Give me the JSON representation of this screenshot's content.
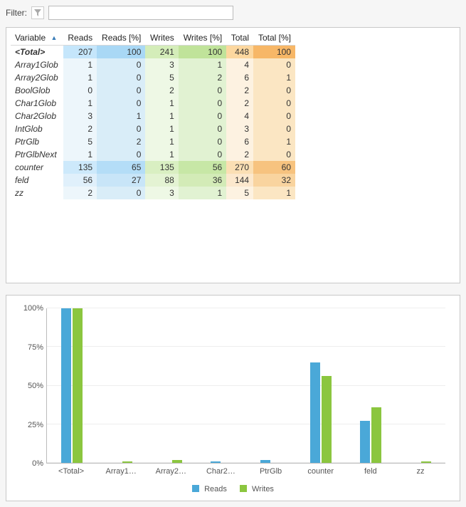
{
  "filter": {
    "label": "Filter:",
    "value": "",
    "placeholder": ""
  },
  "columns": {
    "variable": "Variable",
    "reads": "Reads",
    "reads_pct": "Reads [%]",
    "writes": "Writes",
    "writes_pct": "Writes [%]",
    "total": "Total",
    "total_pct": "Total [%]"
  },
  "rows": [
    {
      "name": "<Total>",
      "reads": 207,
      "reads_pct": 100,
      "writes": 241,
      "writes_pct": 100,
      "total": 448,
      "total_pct": 100,
      "style": "total"
    },
    {
      "name": "Array1Glob",
      "reads": 1,
      "reads_pct": 0,
      "writes": 3,
      "writes_pct": 1,
      "total": 4,
      "total_pct": 0,
      "style": ""
    },
    {
      "name": "Array2Glob",
      "reads": 1,
      "reads_pct": 0,
      "writes": 5,
      "writes_pct": 2,
      "total": 6,
      "total_pct": 1,
      "style": ""
    },
    {
      "name": "BoolGlob",
      "reads": 0,
      "reads_pct": 0,
      "writes": 2,
      "writes_pct": 0,
      "total": 2,
      "total_pct": 0,
      "style": ""
    },
    {
      "name": "Char1Glob",
      "reads": 1,
      "reads_pct": 0,
      "writes": 1,
      "writes_pct": 0,
      "total": 2,
      "total_pct": 0,
      "style": ""
    },
    {
      "name": "Char2Glob",
      "reads": 3,
      "reads_pct": 1,
      "writes": 1,
      "writes_pct": 0,
      "total": 4,
      "total_pct": 0,
      "style": ""
    },
    {
      "name": "IntGlob",
      "reads": 2,
      "reads_pct": 0,
      "writes": 1,
      "writes_pct": 0,
      "total": 3,
      "total_pct": 0,
      "style": ""
    },
    {
      "name": "PtrGlb",
      "reads": 5,
      "reads_pct": 2,
      "writes": 1,
      "writes_pct": 0,
      "total": 6,
      "total_pct": 1,
      "style": ""
    },
    {
      "name": "PtrGlbNext",
      "reads": 1,
      "reads_pct": 0,
      "writes": 1,
      "writes_pct": 0,
      "total": 2,
      "total_pct": 0,
      "style": ""
    },
    {
      "name": "counter",
      "reads": 135,
      "reads_pct": 65,
      "writes": 135,
      "writes_pct": 56,
      "total": 270,
      "total_pct": 60,
      "style": "hot"
    },
    {
      "name": "feld",
      "reads": 56,
      "reads_pct": 27,
      "writes": 88,
      "writes_pct": 36,
      "total": 144,
      "total_pct": 32,
      "style": "warm"
    },
    {
      "name": "zz",
      "reads": 2,
      "reads_pct": 0,
      "writes": 3,
      "writes_pct": 1,
      "total": 5,
      "total_pct": 1,
      "style": ""
    }
  ],
  "chart_data": {
    "type": "bar",
    "ylabel_format": "percent",
    "ylim": [
      0,
      100
    ],
    "yticks": [
      0,
      25,
      50,
      75,
      100
    ],
    "ytick_labels": [
      "0%",
      "25%",
      "50%",
      "75%",
      "100%"
    ],
    "categories": [
      "<Total>",
      "Array1…",
      "Array2…",
      "Char2…",
      "PtrGlb",
      "counter",
      "feld",
      "zz"
    ],
    "series": [
      {
        "name": "Reads",
        "color": "#4aa8d8",
        "values": [
          100,
          0,
          0,
          1,
          2,
          65,
          27,
          0
        ]
      },
      {
        "name": "Writes",
        "color": "#8bc63f",
        "values": [
          100,
          1,
          2,
          0,
          0,
          56,
          36,
          1
        ]
      }
    ],
    "legend": {
      "reads": "Reads",
      "writes": "Writes"
    }
  }
}
